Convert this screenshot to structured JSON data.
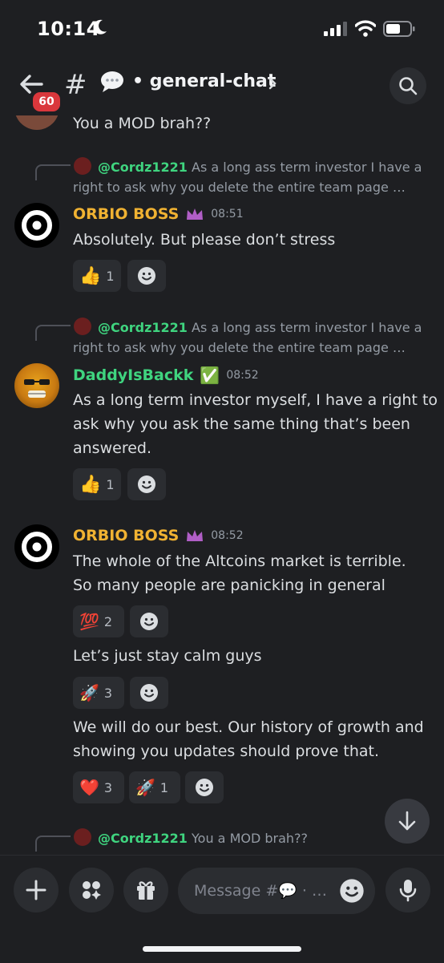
{
  "status": {
    "time": "10:14"
  },
  "header": {
    "badge": "60",
    "hash": "#",
    "separator": "•",
    "channel": "general-chat"
  },
  "messages": {
    "top_partial": "You a MOD brah??",
    "m1": {
      "reply_user": "@Cordz1221",
      "reply_line1": "As a long ass term investor I have a",
      "reply_line2": "right to ask why you delete the entire team page …",
      "author": "ORBIO BOSS",
      "time": "08:51",
      "text": "Absolutely. But please don’t stress",
      "reactions": [
        {
          "emoji": "👍",
          "count": "1"
        }
      ]
    },
    "m2": {
      "reply_user": "@Cordz1221",
      "reply_line1": "As a long ass term investor I have a",
      "reply_line2": "right to ask why you delete the entire team page …",
      "author": "DaddyIsBackk",
      "verified": "✅",
      "time": "08:52",
      "text_line1": "As a long term investor myself, I have a right to",
      "text_line2": "ask why you ask the same thing that’s been",
      "text_line3": "answered.",
      "reactions": [
        {
          "emoji": "👍",
          "count": "1"
        }
      ]
    },
    "m3": {
      "author": "ORBIO BOSS",
      "time": "08:52",
      "text_line1": "The whole of the Altcoins market is terrible.",
      "text_line2": "So many people are panicking in general",
      "reaction_a": {
        "emoji": "💯",
        "count": "2"
      },
      "text2": "Let’s just stay calm guys",
      "reaction_b": {
        "emoji": "🚀",
        "count": "3"
      },
      "text3_line1": "We will do our best. Our history of growth and",
      "text3_line2": "showing you updates should prove that.",
      "reaction_c": [
        {
          "emoji": "❤️",
          "count": "3"
        },
        {
          "emoji": "🚀",
          "count": "1"
        }
      ]
    },
    "m4": {
      "reply_user": "@Cordz1221",
      "reply_text": "You a MOD brah??"
    }
  },
  "input": {
    "placeholder": "Message #💬 · …"
  },
  "colors": {
    "background": "#1e1f22",
    "orange_name": "#f0b232",
    "green_name": "#3fd47f",
    "badge": "#da373c"
  }
}
